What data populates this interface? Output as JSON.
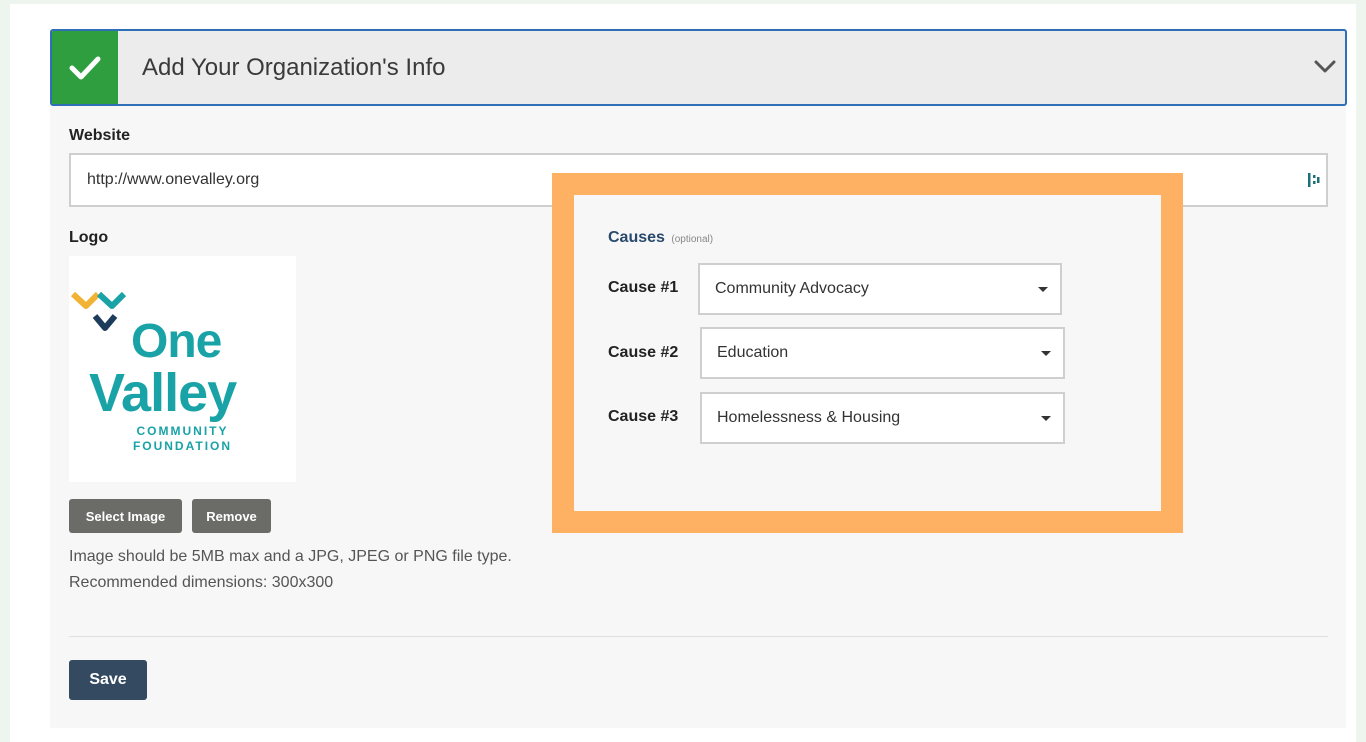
{
  "accordion": {
    "title": "Add Your Organization's Info",
    "status_icon": "check-icon",
    "toggle_icon": "chevron-down-icon",
    "status_color": "#2e9e3e",
    "border_color": "#2f6fb8"
  },
  "website": {
    "label": "Website",
    "value": "http://www.onevalley.org"
  },
  "logo": {
    "label": "Logo",
    "image_text": {
      "line1": "One",
      "line2": "Valley",
      "line3": "COMMUNITY",
      "line4": "FOUNDATION"
    },
    "brand_color": "#1aa3a7",
    "select_label": "Select Image",
    "remove_label": "Remove",
    "help_line1": "Image should be 5MB max and a JPG, JPEG or PNG file type.",
    "help_line2": "Recommended dimensions: 300x300"
  },
  "causes": {
    "heading": "Causes",
    "optional": "(optional)",
    "highlight_color": "#ffb163",
    "items": [
      {
        "label": "Cause #1",
        "value": "Community Advocacy"
      },
      {
        "label": "Cause #2",
        "value": "Education"
      },
      {
        "label": "Cause #3",
        "value": "Homelessness & Housing"
      }
    ]
  },
  "actions": {
    "save_label": "Save"
  }
}
